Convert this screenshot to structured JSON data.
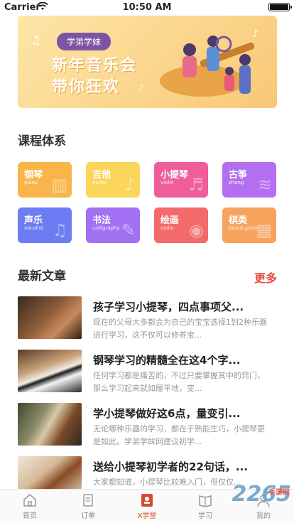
{
  "status_bar": {
    "carrier": "Carrier",
    "time": "10:50 AM"
  },
  "banner": {
    "tag": "学弟学妹",
    "line1": "新年音乐会",
    "line2": "带你狂欢"
  },
  "courses_section": {
    "title": "课程体系"
  },
  "courses": [
    {
      "cn": "钢琴",
      "en": "piano",
      "color": "#f8b54a",
      "icon": "piano-keys"
    },
    {
      "cn": "吉他",
      "en": "guitar",
      "color": "#fcd55b",
      "icon": "guitar"
    },
    {
      "cn": "小提琴",
      "en": "violin",
      "color": "#ef5d9a",
      "icon": "violin"
    },
    {
      "cn": "古筝",
      "en": "zheng",
      "color": "#b46ef0",
      "icon": "zheng"
    },
    {
      "cn": "声乐",
      "en": "vocalist",
      "color": "#6c7cf2",
      "icon": "music-note"
    },
    {
      "cn": "书法",
      "en": "calligraphy",
      "color": "#a270f2",
      "icon": "brush"
    },
    {
      "cn": "绘画",
      "en": "violin",
      "color": "#f26a6a",
      "icon": "palette"
    },
    {
      "cn": "棋类",
      "en": "board game",
      "color": "#f6a35e",
      "icon": "chessboard"
    }
  ],
  "articles_section": {
    "title": "最新文章",
    "more": "更多"
  },
  "articles": [
    {
      "title": "孩子学习小提琴，四点事项父...",
      "desc": "现在的父母大多都会为自己的宝宝选择1到2种乐器进行学习，这不仅可以修养宝..."
    },
    {
      "title": "钢琴学习的精髓全在这4个字...",
      "desc": "任何学习都是痛苦的，不过只要掌握其中的窍门，那么学习起来就如履平地，变..."
    },
    {
      "title": "学小提琴做好这6点，量变引...",
      "desc": "无论哪种乐器的学习，都在于熟能生巧，小提琴更是如此。学弟学妹网建议初学..."
    },
    {
      "title": "送给小提琴初学者的22句话，...",
      "desc": "大家都知道，小提琴比较难入门，但仅仅..."
    }
  ],
  "tabbar": [
    {
      "label": "首页",
      "active": false
    },
    {
      "label": "订单",
      "active": false
    },
    {
      "label": "X学堂",
      "active": true
    },
    {
      "label": "学习",
      "active": false
    },
    {
      "label": "我的",
      "active": false
    }
  ],
  "watermark": {
    "text": "2265",
    "sub": "手游网"
  }
}
